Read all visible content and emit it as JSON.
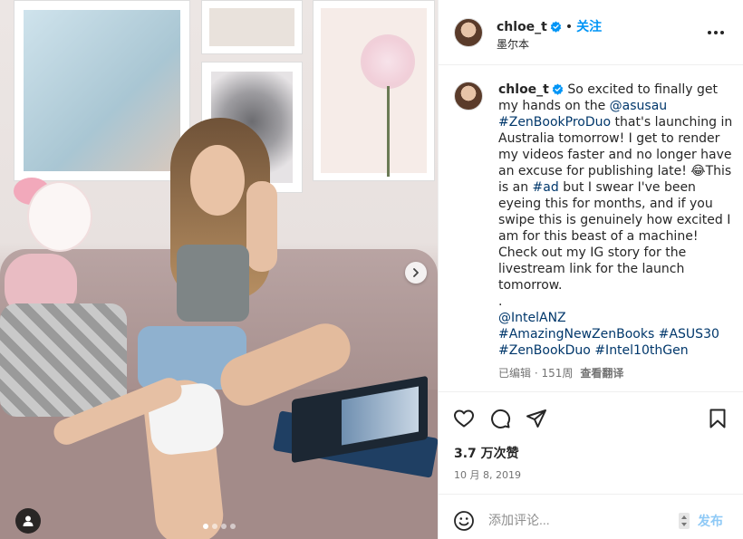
{
  "header": {
    "username": "chloe_t",
    "separator": "•",
    "follow_label": "关注",
    "location": "墨尔本"
  },
  "caption": {
    "username": "chloe_t",
    "text_1": " So excited to finally get my hands on the ",
    "mention_asus": "@asusau",
    "text_2": " ",
    "hashtag_zenbookproduo": "#ZenBookProDuo",
    "text_3": " that's launching in Australia tomorrow! I get to render my videos faster and no longer have an excuse for publishing late! 😂This is an ",
    "hashtag_ad": "#ad",
    "text_4": " but I swear I've been eyeing this for months, and if you swipe this is genuinely how excited I am for this beast of a machine! Check out my IG story for the livestream link for the launch tomorrow.",
    "dot_line": ".",
    "mention_intel": "@IntelANZ",
    "hashtag_amazing": "#AmazingNewZenBooks",
    "hashtag_asus30": "#ASUS30",
    "hashtag_zenbookduo": "#ZenBookDuo",
    "hashtag_intel10th": "#Intel10thGen"
  },
  "meta": {
    "edited": "已编辑 · 151周",
    "translate": "查看翻译"
  },
  "stats": {
    "likes": "3.7 万次赞",
    "date": "10 月 8, 2019"
  },
  "comment": {
    "placeholder": "添加评论...",
    "post_label": "发布"
  },
  "carousel": {
    "slide_count": 4,
    "active_index": 0
  },
  "icons": {
    "verified": "verified-badge-icon",
    "more": "more-options-icon",
    "like": "heart-icon",
    "comment": "comment-icon",
    "share": "share-icon",
    "save": "bookmark-icon",
    "emoji": "emoji-icon",
    "next": "chevron-right-icon",
    "tag": "user-tag-icon"
  },
  "colors": {
    "accent": "#0095f6",
    "link": "#00376b",
    "muted": "#737373",
    "post_disabled": "#8ec9f6"
  }
}
